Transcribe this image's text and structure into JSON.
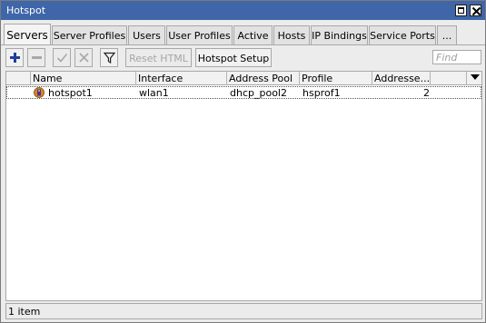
{
  "window": {
    "title": "Hotspot"
  },
  "tabs": [
    {
      "label": "Servers",
      "active": true
    },
    {
      "label": "Server Profiles"
    },
    {
      "label": "Users"
    },
    {
      "label": "User Profiles"
    },
    {
      "label": "Active"
    },
    {
      "label": "Hosts"
    },
    {
      "label": "IP Bindings"
    },
    {
      "label": "Service Ports"
    },
    {
      "label": "..."
    }
  ],
  "toolbar": {
    "icons": [
      "add-icon",
      "remove-icon",
      "enable-icon",
      "disable-icon",
      "filter-icon"
    ],
    "reset_html_label": "Reset HTML",
    "hotspot_setup_label": "Hotspot Setup",
    "find_placeholder": "Find"
  },
  "table": {
    "columns": [
      "Name",
      "Interface",
      "Address Pool",
      "Profile",
      "Addresse..."
    ],
    "rows": [
      {
        "name": "hotspot1",
        "interface": "wlan1",
        "address_pool": "dhcp_pool2",
        "profile": "hsprof1",
        "addresses": "2"
      }
    ]
  },
  "status": {
    "item_count": "1 item"
  },
  "colors": {
    "titlebar": "#3f66a8",
    "add_icon": "#1f3f9a",
    "server_icon": "#d08a1e"
  }
}
